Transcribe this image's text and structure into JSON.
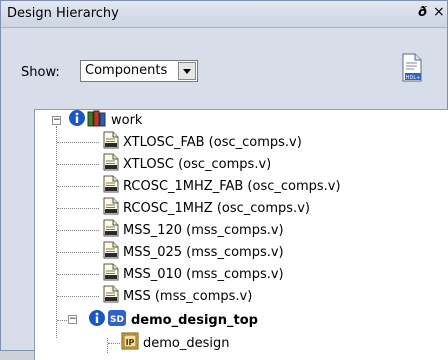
{
  "panel": {
    "title": "Design Hierarchy",
    "pin_glyph": "ᴫ",
    "close_glyph": "×"
  },
  "show": {
    "label": "Show:",
    "value": "Components"
  },
  "tree": {
    "root": {
      "label": "work",
      "expanded_glyph": "−"
    },
    "files": [
      "XTLOSC_FAB (osc_comps.v)",
      "XTLOSC (osc_comps.v)",
      "RCOSC_1MHZ_FAB (osc_comps.v)",
      "RCOSC_1MHZ (osc_comps.v)",
      "MSS_120 (mss_comps.v)",
      "MSS_025 (mss_comps.v)",
      "MSS_010 (mss_comps.v)",
      "MSS (mss_comps.v)"
    ],
    "top": {
      "label": "demo_design_top",
      "expanded_glyph": "−",
      "badge": "SD"
    },
    "child": {
      "label": "demo_design",
      "badge": "IP"
    }
  },
  "colors": {
    "info_blue": "#1a56c8",
    "books_green": "#3f7a2a",
    "file_yellow": "#fffbe0"
  },
  "icons": {
    "info": "info-icon",
    "library": "library-books-icon",
    "file": "hdl-file-icon",
    "smartdesign": "smartdesign-icon",
    "ip": "ip-core-icon",
    "new_hdl": "new-hdl-file-icon"
  }
}
